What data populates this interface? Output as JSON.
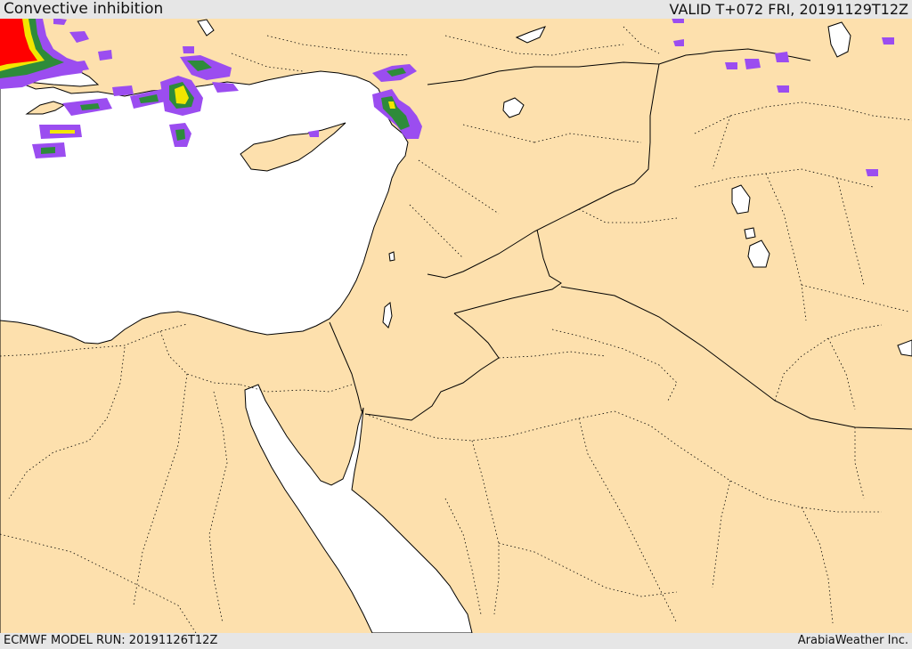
{
  "header": {
    "title": "Convective inhibition",
    "valid": "VALID T+072 FRI, 20191129T12Z"
  },
  "footer": {
    "model_run": "ECMWF MODEL RUN: 20191126T12Z",
    "credit": "ArabiaWeather Inc."
  },
  "colors": {
    "land": "#fde0ad",
    "sea": "#ffffff",
    "coast": "#000000",
    "bar": "#e6e6e6",
    "cin_scale": [
      "#9b4df0",
      "#2e8b3a",
      "#f2e600",
      "#ff0000"
    ]
  }
}
